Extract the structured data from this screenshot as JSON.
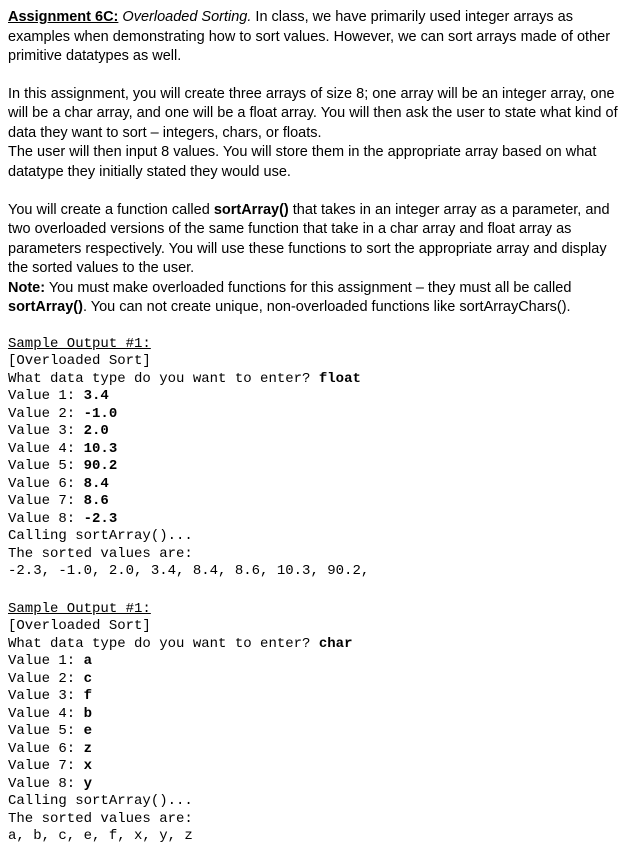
{
  "heading": {
    "label": "Assignment 6C:",
    "title": "Overloaded Sorting.",
    "intro_rest": "  In class, we have primarily used integer arrays as examples when demonstrating how to sort values. However, we can sort arrays made of other primitive datatypes as well."
  },
  "para2": "In this assignment, you will create three arrays of size 8; one array will be an integer array, one will be a char array, and one will be a float array. You will then ask the user to state what kind of data they want to sort – integers, chars, or floats.",
  "para2b": "The user will then input 8 values. You will store them in the appropriate array based on what datatype they initially stated they would use.",
  "para3a": "You will create a function called ",
  "para3_fn": "sortArray()",
  "para3b": " that takes in an integer array as a parameter, and two overloaded versions of the same function that take in a char array and float array as parameters respectively. You will use these functions to sort the appropriate array and display the sorted values to the user.",
  "note_label": "Note:",
  "note_text_a": " You must make overloaded functions for this assignment – they must all be called ",
  "note_fn": "sortArray()",
  "note_text_b": ". You can not create unique, non-overloaded functions like sortArrayChars().",
  "sample1": {
    "heading": "Sample Output #1:",
    "header": "[Overloaded Sort]",
    "prompt": "What data type do you want to enter? ",
    "answer": "float",
    "values": [
      {
        "label": "Value 1: ",
        "val": "3.4"
      },
      {
        "label": "Value 2: ",
        "val": "-1.0"
      },
      {
        "label": "Value 3: ",
        "val": "2.0"
      },
      {
        "label": "Value 4: ",
        "val": "10.3"
      },
      {
        "label": "Value 5: ",
        "val": "90.2"
      },
      {
        "label": "Value 6: ",
        "val": "8.4"
      },
      {
        "label": "Value 7: ",
        "val": "8.6"
      },
      {
        "label": "Value 8: ",
        "val": "-2.3"
      }
    ],
    "calling": "Calling sortArray()...",
    "sorted_label": "The sorted values are:",
    "sorted": "-2.3, -1.0, 2.0, 3.4, 8.4, 8.6, 10.3, 90.2,"
  },
  "sample2": {
    "heading": "Sample Output #1:",
    "header": "[Overloaded Sort]",
    "prompt": "What data type do you want to enter? ",
    "answer": "char",
    "values": [
      {
        "label": "Value 1: ",
        "val": "a"
      },
      {
        "label": "Value 2: ",
        "val": "c"
      },
      {
        "label": "Value 3: ",
        "val": "f"
      },
      {
        "label": "Value 4: ",
        "val": "b"
      },
      {
        "label": "Value 5: ",
        "val": "e"
      },
      {
        "label": "Value 6: ",
        "val": "z"
      },
      {
        "label": "Value 7: ",
        "val": "x"
      },
      {
        "label": "Value 8: ",
        "val": "y"
      }
    ],
    "calling": "Calling sortArray()...",
    "sorted_label": "The sorted values are:",
    "sorted": "a, b, c, e, f, x, y, z"
  }
}
